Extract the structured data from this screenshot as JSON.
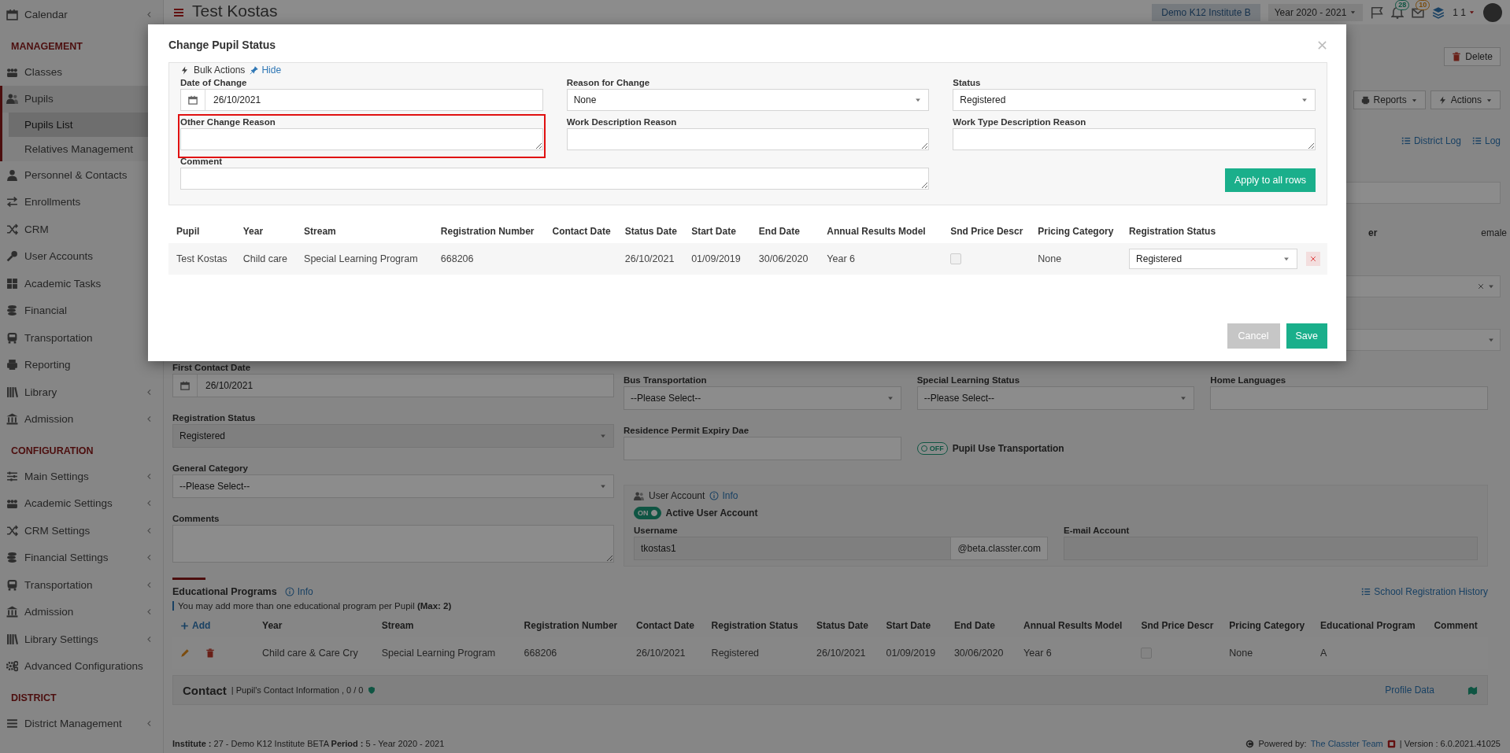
{
  "sidebar": {
    "items": [
      {
        "kind": "item",
        "label": "Calendar",
        "chevron": true,
        "selected": false
      },
      {
        "kind": "header",
        "label": "MANAGEMENT"
      },
      {
        "kind": "item",
        "label": "Classes",
        "chevron": false,
        "selected": false
      },
      {
        "kind": "item",
        "label": "Pupils",
        "chevron": false,
        "selected": true,
        "children": [
          {
            "label": "Pupils List",
            "selected": true
          },
          {
            "label": "Relatives Management",
            "selected": false
          }
        ]
      },
      {
        "kind": "item",
        "label": "Personnel & Contacts",
        "chevron": false,
        "selected": false
      },
      {
        "kind": "item",
        "label": "Enrollments",
        "chevron": false,
        "selected": false
      },
      {
        "kind": "item",
        "label": "CRM",
        "chevron": false,
        "selected": false
      },
      {
        "kind": "item",
        "label": "User Accounts",
        "chevron": false,
        "selected": false
      },
      {
        "kind": "item",
        "label": "Academic Tasks",
        "chevron": false,
        "selected": false
      },
      {
        "kind": "item",
        "label": "Financial",
        "chevron": false,
        "selected": false
      },
      {
        "kind": "item",
        "label": "Transportation",
        "chevron": false,
        "selected": false
      },
      {
        "kind": "item",
        "label": "Reporting",
        "chevron": false,
        "selected": false
      },
      {
        "kind": "item",
        "label": "Library",
        "chevron": true,
        "selected": false
      },
      {
        "kind": "item",
        "label": "Admission",
        "chevron": true,
        "selected": false
      },
      {
        "kind": "header",
        "label": "CONFIGURATION"
      },
      {
        "kind": "item",
        "label": "Main Settings",
        "chevron": true,
        "selected": false
      },
      {
        "kind": "item",
        "label": "Academic Settings",
        "chevron": true,
        "selected": false
      },
      {
        "kind": "item",
        "label": "CRM Settings",
        "chevron": true,
        "selected": false
      },
      {
        "kind": "item",
        "label": "Financial Settings",
        "chevron": true,
        "selected": false
      },
      {
        "kind": "item",
        "label": "Transportation",
        "chevron": true,
        "selected": false
      },
      {
        "kind": "item",
        "label": "Admission",
        "chevron": true,
        "selected": false
      },
      {
        "kind": "item",
        "label": "Library Settings",
        "chevron": true,
        "selected": false
      },
      {
        "kind": "item",
        "label": "Advanced Configurations",
        "chevron": false,
        "selected": false
      },
      {
        "kind": "header",
        "label": "DISTRICT"
      },
      {
        "kind": "item",
        "label": "District Management",
        "chevron": true,
        "selected": false
      }
    ]
  },
  "header": {
    "title": "Test Kostas",
    "institute": "Demo K12 Institute B",
    "year": "Year 2020 - 2021",
    "notifications": "28",
    "messages": "10",
    "user": "1 1"
  },
  "toolbar": {
    "delete": "Delete",
    "reports": "Reports",
    "actions": "Actions",
    "district_log": "District Log",
    "log": "Log",
    "partial_label": "er",
    "partial_option": "emale"
  },
  "modal": {
    "title": "Change Pupil Status",
    "bulk_actions": {
      "label": "Bulk Actions",
      "hide_link": "Hide",
      "fields": [
        {
          "kind": "date",
          "label": "Date of Change",
          "value": "26/10/2021",
          "highlighted": false
        },
        {
          "kind": "select",
          "label": "Reason for Change",
          "value": "None",
          "highlighted": false
        },
        {
          "kind": "select",
          "label": "Status",
          "value": "Registered",
          "highlighted": false
        },
        {
          "kind": "textarea",
          "label": "Other Change Reason",
          "highlighted": true
        },
        {
          "kind": "textarea",
          "label": "Work Description Reason",
          "highlighted": false
        },
        {
          "kind": "textarea",
          "label": "Work Type Description Reason",
          "highlighted": false
        },
        {
          "kind": "textarea",
          "label": "Comment",
          "highlighted": false
        }
      ],
      "apply_button": "Apply to all rows"
    },
    "table": {
      "columns": [
        "Pupil",
        "Year",
        "Stream",
        "Registration Number",
        "Contact Date",
        "Status Date",
        "Start Date",
        "End Date",
        "Annual Results Model",
        "Snd Price Descr",
        "Pricing Category",
        "Registration Status"
      ],
      "rows": [
        {
          "cells": [
            {
              "kind": "text",
              "text": "Test Kostas"
            },
            {
              "kind": "text",
              "text": "Child care"
            },
            {
              "kind": "text",
              "text": "Special Learning Program"
            },
            {
              "kind": "text",
              "text": "668206"
            },
            {
              "kind": "empty"
            },
            {
              "kind": "text",
              "text": "26/10/2021"
            },
            {
              "kind": "text",
              "text": "01/09/2019"
            },
            {
              "kind": "text",
              "text": "30/06/2020"
            },
            {
              "kind": "text",
              "text": "Year 6"
            },
            {
              "kind": "checkbox",
              "checked": false
            },
            {
              "kind": "text",
              "text": "None"
            },
            {
              "kind": "select",
              "value": "Registered"
            }
          ]
        }
      ]
    },
    "cancel_button": "Cancel",
    "save_button": "Save"
  },
  "form": {
    "column_1": [
      {
        "kind": "date",
        "label": "First Contact Date",
        "value": "26/10/2021",
        "disabled": false
      },
      {
        "kind": "select",
        "label": "Registration Status",
        "value": "Registered",
        "disabled": true
      },
      {
        "kind": "select",
        "label": "General Category",
        "value": "--Please Select--",
        "disabled": false
      },
      {
        "kind": "textarea",
        "label": "Comments",
        "disabled": false
      }
    ],
    "row_1": [
      {
        "kind": "select",
        "label": "Bus Transportation",
        "value": "--Please Select--",
        "disabled": false
      },
      {
        "kind": "select",
        "label": "Special Learning Status",
        "value": "--Please Select--",
        "disabled": false
      },
      {
        "kind": "input",
        "label": "Home Languages",
        "disabled": false
      }
    ],
    "row_2": [
      {
        "kind": "input",
        "label": "Residence Permit Expiry Dae",
        "disabled": false
      },
      {
        "kind": "toggle",
        "label": "Pupil Use Transportation",
        "text": "OFF",
        "on": false
      }
    ],
    "user_account": {
      "title": "User Account",
      "info_link": "Info",
      "toggle": {
        "label": "Active User Account",
        "text": "ON",
        "on": true
      },
      "username": {
        "label": "Username",
        "value": "tkostas1",
        "suffix": "@beta.classter.com"
      },
      "email": {
        "label": "E-mail Account"
      }
    }
  },
  "educational_programs": {
    "title": "Educational Programs",
    "info_link": "Info",
    "history_link": "School Registration History",
    "note": "You may add more than one educational program per Pupil **(Max: 2)**",
    "add_link": "Add",
    "columns": [
      "Year",
      "Stream",
      "Registration Number",
      "Contact Date",
      "Registration Status",
      "Status Date",
      "Start Date",
      "End Date",
      "Annual Results Model",
      "Snd Price Descr",
      "Pricing Category",
      "Educational Program",
      "Comment"
    ],
    "rows": [
      {
        "cells": [
          {
            "kind": "text",
            "text": "Child care & Care Cry"
          },
          {
            "kind": "text",
            "text": "Special Learning Program"
          },
          {
            "kind": "text",
            "text": "668206"
          },
          {
            "kind": "text",
            "text": "26/10/2021"
          },
          {
            "kind": "text",
            "text": "Registered"
          },
          {
            "kind": "text",
            "text": "26/10/2021"
          },
          {
            "kind": "text",
            "text": "01/09/2019"
          },
          {
            "kind": "text",
            "text": "30/06/2020"
          },
          {
            "kind": "text",
            "text": "Year 6"
          },
          {
            "kind": "checkbox",
            "checked": false
          },
          {
            "kind": "text",
            "text": "None"
          },
          {
            "kind": "text",
            "text": "A"
          },
          {
            "kind": "empty"
          }
        ]
      }
    ]
  },
  "contact": {
    "title": "Contact",
    "subtitle": "| Pupil's Contact Information , 0 / 0",
    "profile_link": "Profile Data"
  },
  "footer": {
    "info": "**Institute :** 27 - Demo K12 Institute BETA **Period :** 5 - Year 2020 - 2021",
    "powered_by": "Powered by:",
    "team_link": "The Classter Team",
    "version": "| Version : 6.0.2021.41025"
  }
}
